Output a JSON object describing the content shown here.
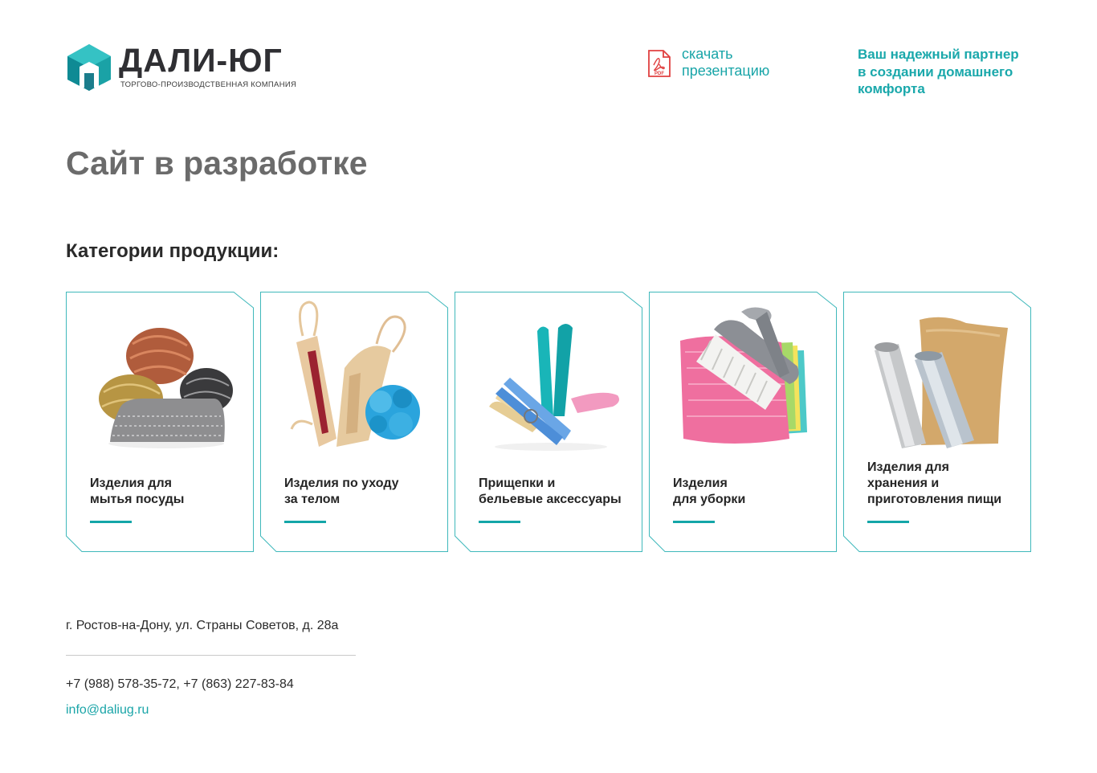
{
  "brand": {
    "name": "ДАЛИ-ЮГ",
    "tagline": "ТОРГОВО-ПРОИЗВОДСТВЕННАЯ КОМПАНИЯ",
    "accent_color": "#1aa8ab",
    "dark_color": "#2f2f33"
  },
  "header": {
    "pdf_icon": "pdf-file-icon",
    "pdf_badge": "PDF",
    "download_line1": "скачать",
    "download_line2": "презентацию",
    "slogan_line1": "Ваш надежный партнер",
    "slogan_line2": "в создании домашнего",
    "slogan_line3": "комфорта"
  },
  "main": {
    "title": "Сайт в разработке",
    "categories_title": "Категории продукции:"
  },
  "categories": [
    {
      "line1": "Изделия для",
      "line2": "мытья посуды",
      "image": "dish-scrubbers-image"
    },
    {
      "line1": "Изделия по уходу",
      "line2": "за телом",
      "image": "bath-accessories-image"
    },
    {
      "line1": "Прищепки и",
      "line2": "бельевые аксессуары",
      "image": "clothespins-image"
    },
    {
      "line1": "Изделия",
      "line2": "для уборки",
      "image": "cleaning-cloths-brush-image"
    },
    {
      "line1": "Изделия для",
      "line2": "хранения и",
      "line3": "приготовления пищи",
      "image": "foil-film-paper-rolls-image"
    }
  ],
  "footer": {
    "address": "г. Ростов-на-Дону, ул. Страны Советов, д. 28а",
    "phones": "+7 (988) 578-35-72, +7 (863) 227-83-84",
    "email": "info@daliug.ru"
  }
}
